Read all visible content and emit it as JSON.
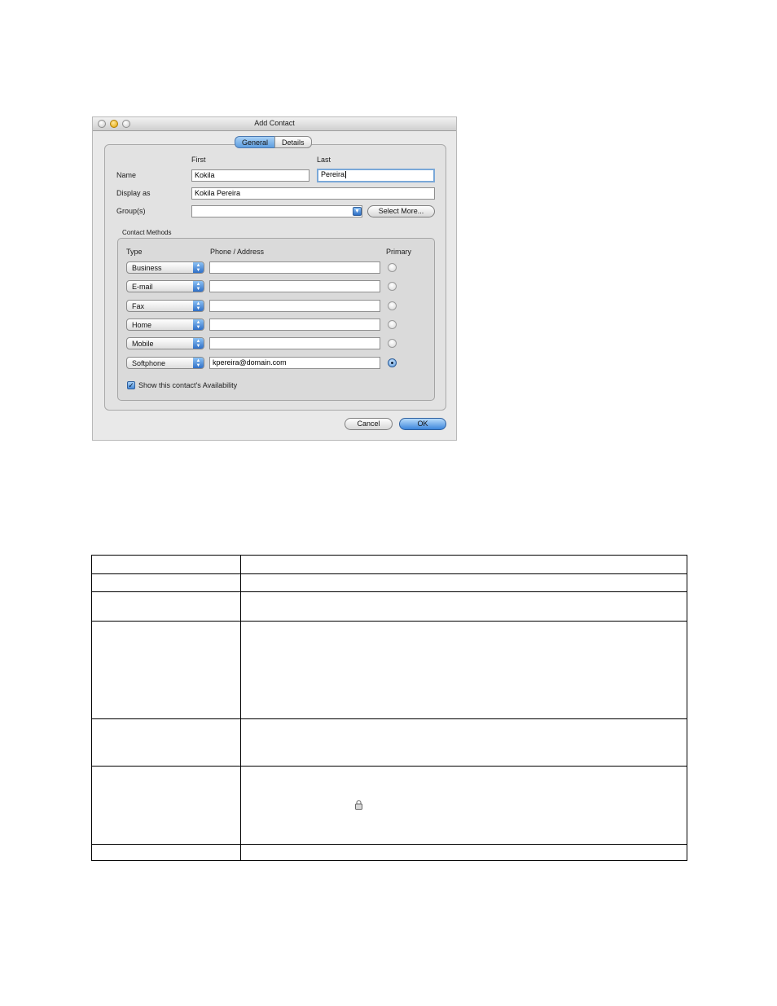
{
  "window": {
    "title": "Add Contact",
    "tabs": [
      {
        "label": "General",
        "active": true
      },
      {
        "label": "Details",
        "active": false
      }
    ]
  },
  "form": {
    "col_first": "First",
    "col_last": "Last",
    "name_label": "Name",
    "first_name": "Kokila",
    "last_name": "Pereira",
    "display_label": "Display as",
    "display_value": "Kokila  Pereira",
    "groups_label": "Group(s)",
    "groups_value": "",
    "select_more": "Select More..."
  },
  "contact_methods": {
    "legend": "Contact Methods",
    "col_type": "Type",
    "col_address": "Phone / Address",
    "col_primary": "Primary",
    "rows": [
      {
        "type": "Business",
        "value": "",
        "primary": false
      },
      {
        "type": "E-mail",
        "value": "",
        "primary": false
      },
      {
        "type": "Fax",
        "value": "",
        "primary": false
      },
      {
        "type": "Home",
        "value": "",
        "primary": false
      },
      {
        "type": "Mobile",
        "value": "",
        "primary": false
      },
      {
        "type": "Softphone",
        "value": "kpereira@domain.com",
        "primary": true
      }
    ],
    "availability_label": "Show this contact's Availability",
    "availability_checked": true
  },
  "buttons": {
    "cancel": "Cancel",
    "ok": "OK"
  },
  "icons": {
    "lock": "lock-icon",
    "groups_dropdown": "chevron-down-icon",
    "popup_arrows": "up-down-arrows-icon"
  },
  "colors": {
    "accent": "#4a89d8",
    "window_bg": "#e9e9e9"
  }
}
